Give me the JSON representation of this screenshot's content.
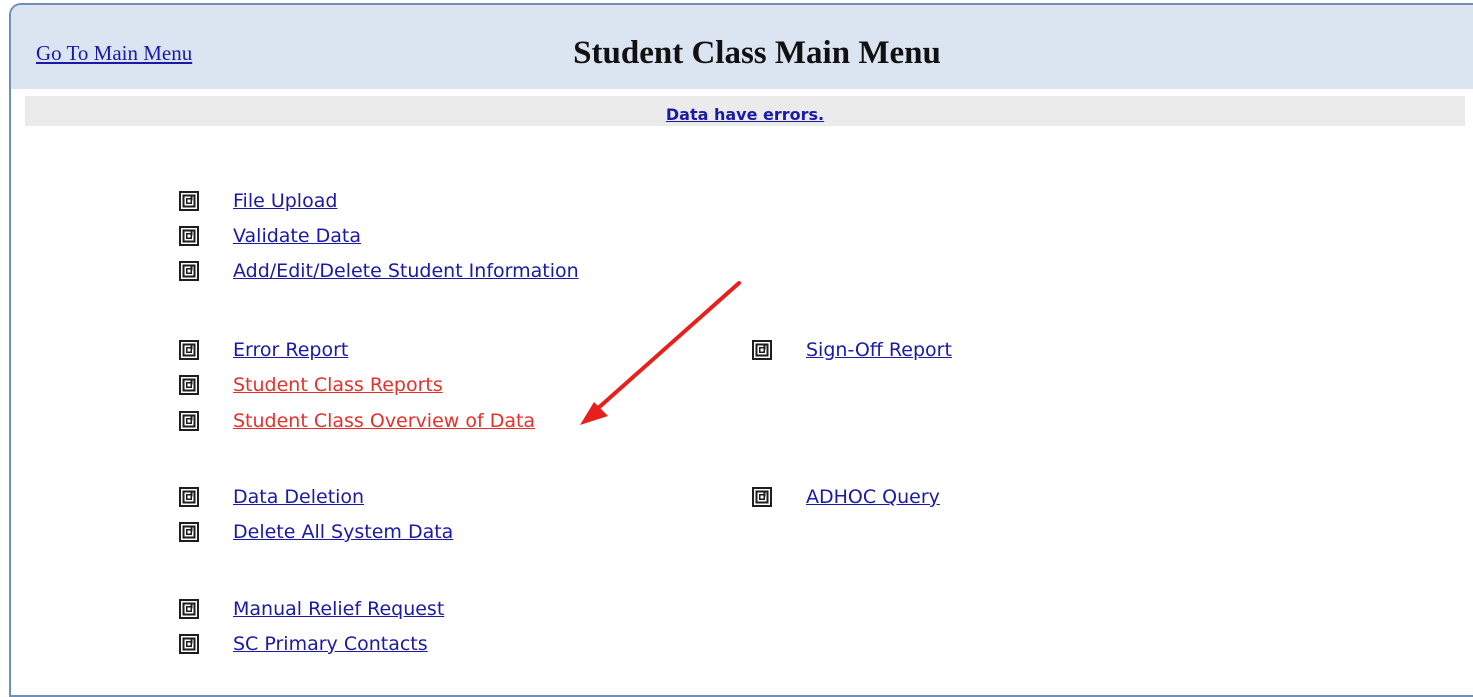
{
  "header": {
    "main_menu_link": "Go To Main Menu",
    "title": "Student Class Main Menu"
  },
  "status": {
    "message": "Data have errors."
  },
  "menu": {
    "group1": [
      {
        "label": "File Upload",
        "color": "#1a1aa6"
      },
      {
        "label": "Validate Data",
        "color": "#1a1aa6"
      },
      {
        "label": "Add/Edit/Delete Student Information",
        "color": "#1a1aa6"
      }
    ],
    "group2": [
      {
        "label": "Error Report",
        "color": "#1a1aa6"
      },
      {
        "label": "Student Class Reports",
        "color": "#e5312c"
      },
      {
        "label": "Student Class Overview of Data",
        "color": "#e5312c"
      }
    ],
    "group2_right": [
      {
        "label": "Sign-Off Report",
        "color": "#1a1aa6"
      }
    ],
    "group3": [
      {
        "label": "Data Deletion",
        "color": "#1a1aa6"
      },
      {
        "label": "Delete All System Data",
        "color": "#1a1aa6"
      }
    ],
    "group3_right": [
      {
        "label": "ADHOC Query",
        "color": "#1a1aa6"
      }
    ],
    "group4": [
      {
        "label": "Manual Relief Request",
        "color": "#1a1aa6"
      },
      {
        "label": "SC Primary Contacts",
        "color": "#1a1aa6"
      }
    ]
  },
  "icon": "square-spiral-icon",
  "annotation": {
    "arrow_color": "#e8201c"
  }
}
